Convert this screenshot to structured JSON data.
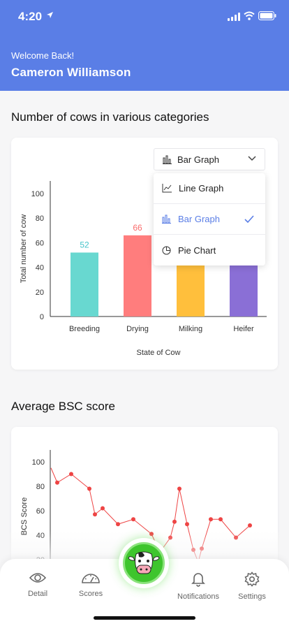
{
  "status_bar": {
    "time": "4:20"
  },
  "header": {
    "welcome": "Welcome  Back!",
    "name": "Cameron Williamson"
  },
  "cows_section": {
    "title": "Number of cows in various categories",
    "graph_select": {
      "value": "Bar Graph",
      "options": [
        "Line Graph",
        "Bar Graph",
        "Pie Chart"
      ],
      "selected": "Bar Graph"
    }
  },
  "bsc_section": {
    "title": "Average  BSC score"
  },
  "chart_data": [
    {
      "type": "bar",
      "categories": [
        "Breeding",
        "Drying",
        "Milking",
        "Heifer"
      ],
      "values": [
        52,
        66,
        60,
        60
      ],
      "data_labels": [
        "52",
        "66"
      ],
      "xlabel": "State of Cow",
      "ylabel": "Total number of cow",
      "yticks": [
        "0",
        "20",
        "40",
        "60",
        "80",
        "100"
      ],
      "ylim": [
        0,
        100
      ],
      "colors": [
        "#68d8d0",
        "#ff7d7d",
        "#ffbf3c",
        "#8a6fd6"
      ],
      "label_colors": [
        "#45c3c9",
        "#f96b6b"
      ],
      "grid": false
    },
    {
      "type": "line",
      "ylabel": "BCS Score",
      "yticks": [
        "100",
        "80",
        "60",
        "40",
        "20"
      ],
      "ylim": [
        20,
        100
      ],
      "x": [
        1,
        2,
        3,
        4,
        5,
        6,
        7,
        8,
        9,
        10,
        11,
        12,
        13,
        14,
        15,
        16,
        17,
        18,
        19,
        20,
        21,
        22,
        23
      ],
      "values": [
        95,
        83,
        90,
        78,
        57,
        62,
        49,
        53,
        41,
        26,
        38,
        51,
        78,
        49,
        28,
        18,
        29,
        53,
        53,
        38,
        48
      ],
      "color": "#ee4444",
      "grid": false
    }
  ],
  "tabbar": {
    "items": [
      {
        "label": "Detail",
        "icon": "eye-icon"
      },
      {
        "label": "Scores",
        "icon": "gauge-icon"
      },
      {
        "label": "Notifications",
        "icon": "bell-icon"
      },
      {
        "label": "Settings",
        "icon": "gear-icon"
      }
    ],
    "center": {
      "icon": "cow-logo-icon"
    }
  },
  "colors": {
    "primary": "#5a7ee6",
    "accent_green": "#3ec52d"
  }
}
